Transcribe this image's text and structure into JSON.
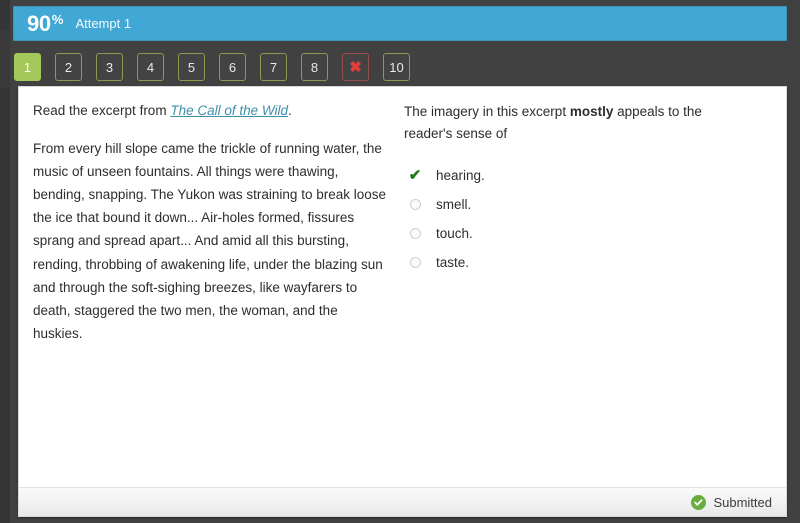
{
  "header": {
    "score_value": "90",
    "score_unit": "%",
    "attempt_label": "Attempt 1"
  },
  "question_nav": {
    "items": [
      {
        "label": "1",
        "state": "active"
      },
      {
        "label": "2",
        "state": "default"
      },
      {
        "label": "3",
        "state": "default"
      },
      {
        "label": "4",
        "state": "default"
      },
      {
        "label": "5",
        "state": "default"
      },
      {
        "label": "6",
        "state": "default"
      },
      {
        "label": "7",
        "state": "default"
      },
      {
        "label": "8",
        "state": "default"
      },
      {
        "label": "✖",
        "state": "wrong",
        "icon": "x-mark-icon"
      },
      {
        "label": "10",
        "state": "default"
      }
    ]
  },
  "passage": {
    "instruction_prefix": "Read the excerpt from ",
    "source_title": "The Call of the Wild",
    "instruction_suffix": ".",
    "excerpt": "From every hill slope came the trickle of running water, the music of unseen fountains. All things were thawing, bending, snapping. The Yukon was straining to break loose the ice that bound it down... Air-holes formed, fissures sprang and spread apart... And amid all this bursting, rending, throbbing of awakening life, under the blazing sun and through the soft-sighing breezes, like wayfarers to death, staggered the two men, the woman, and the huskies."
  },
  "question": {
    "text_before_bold": "The imagery in this excerpt ",
    "bold_word": "mostly",
    "text_after_bold": " appeals to the reader's sense of",
    "choices": [
      {
        "label": "hearing.",
        "marker": "check-icon",
        "selected": true
      },
      {
        "label": "smell.",
        "marker": "radio-icon",
        "selected": false
      },
      {
        "label": "touch.",
        "marker": "radio-icon",
        "selected": false
      },
      {
        "label": "taste.",
        "marker": "radio-icon",
        "selected": false
      }
    ]
  },
  "footer": {
    "status_label": "Submitted",
    "status_icon": "check-circle-icon"
  },
  "colors": {
    "banner_blue": "#41a7d4",
    "active_green": "#a5c85a",
    "wrong_red": "#e2403c",
    "check_green": "#1f7a1f",
    "badge_green": "#68ad3e",
    "link_teal": "#3f8fa8",
    "page_dark": "#414141"
  }
}
